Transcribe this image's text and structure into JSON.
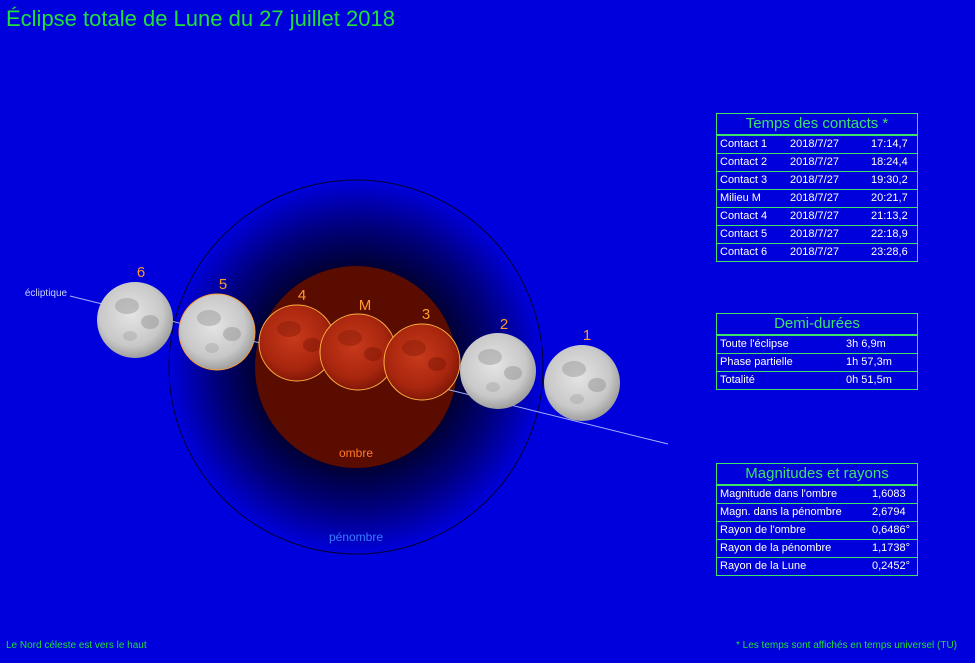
{
  "title": "Éclipse totale de Lune du 27 juillet 2018",
  "diagram": {
    "ecliptic_label": "écliptique",
    "umbra_label": "ombre",
    "penumbra_label": "pénombre",
    "moon_labels": [
      "6",
      "5",
      "4",
      "M",
      "3",
      "2",
      "1"
    ]
  },
  "contacts_table": {
    "header": "Temps des contacts *",
    "rows": [
      {
        "name": "Contact 1",
        "date": "2018/7/27",
        "time": "17:14,7"
      },
      {
        "name": "Contact 2",
        "date": "2018/7/27",
        "time": "18:24,4"
      },
      {
        "name": "Contact 3",
        "date": "2018/7/27",
        "time": "19:30,2"
      },
      {
        "name": "Milieu M",
        "date": "2018/7/27",
        "time": "20:21,7"
      },
      {
        "name": "Contact 4",
        "date": "2018/7/27",
        "time": "21:13,2"
      },
      {
        "name": "Contact 5",
        "date": "2018/7/27",
        "time": "22:18,9"
      },
      {
        "name": "Contact 6",
        "date": "2018/7/27",
        "time": "23:28,6"
      }
    ]
  },
  "demi_durees_table": {
    "header": "Demi-durées",
    "rows": [
      {
        "label": "Toute l'éclipse",
        "value": "3h 6,9m"
      },
      {
        "label": "Phase partielle",
        "value": "1h 57,3m"
      },
      {
        "label": "Totalité",
        "value": "0h 51,5m"
      }
    ]
  },
  "magnitudes_table": {
    "header": "Magnitudes et rayons",
    "rows": [
      {
        "label": "Magnitude dans l'ombre",
        "value": "1,6083"
      },
      {
        "label": "Magn. dans la pénombre",
        "value": "2,6794"
      },
      {
        "label": "Rayon de l'ombre",
        "value": "0,6486°"
      },
      {
        "label": "Rayon de la pénombre",
        "value": "1,1738°"
      },
      {
        "label": "Rayon de la Lune",
        "value": "0,2452°"
      }
    ]
  },
  "footer_left": "Le Nord céleste est vers le haut",
  "footer_right": "* Les temps sont affichés en temps universel (TU)",
  "colors": {
    "background": "#0000dc",
    "title": "#1fe03a",
    "table_border": "#3de26a",
    "moon_label": "#ff9a2e",
    "umbra": "#5a0c00",
    "eclipsed_moon": "#b42a14"
  }
}
